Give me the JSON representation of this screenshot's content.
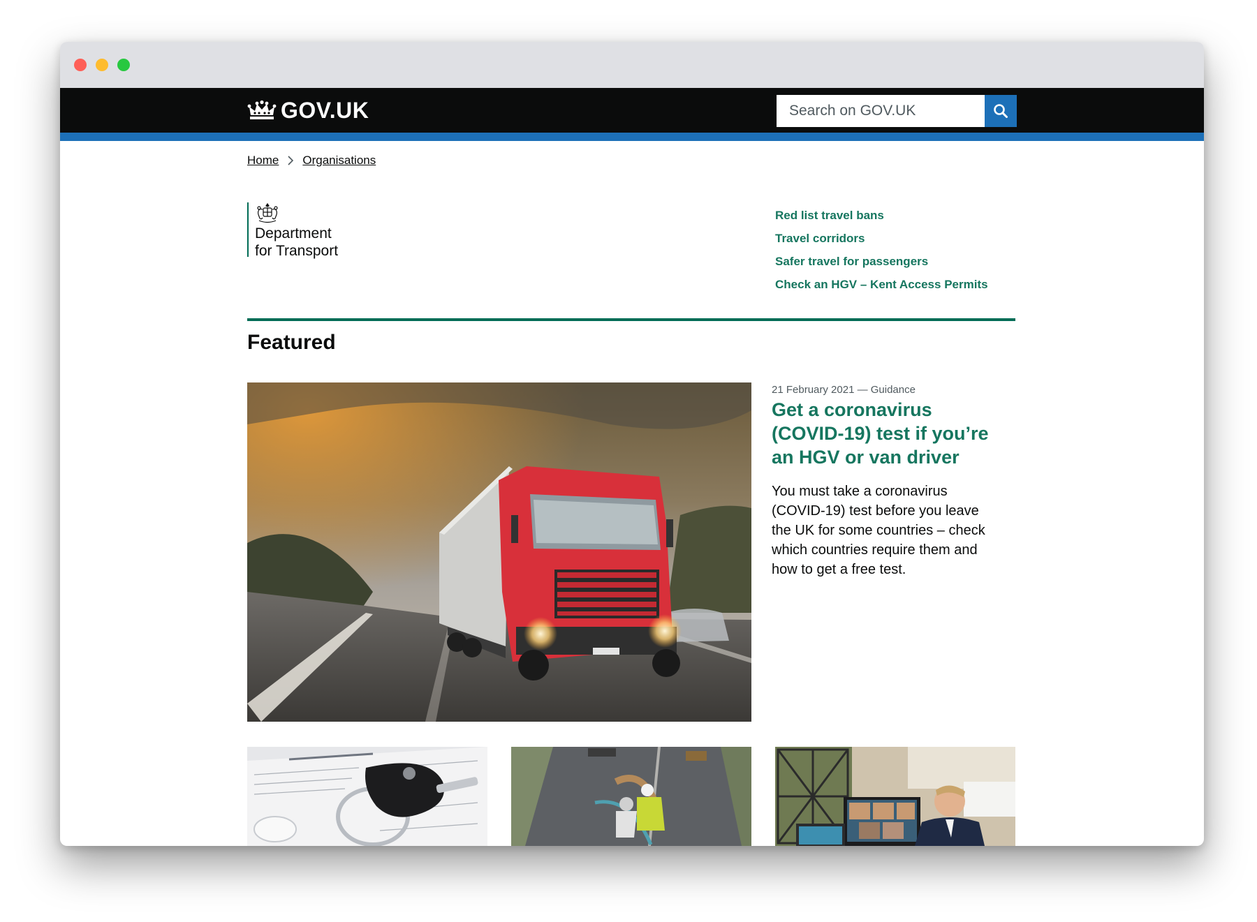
{
  "window": {
    "controls": [
      "close",
      "minimize",
      "maximize"
    ]
  },
  "header": {
    "logo_text": "GOV.UK",
    "logo_icon": "crown-icon",
    "search_placeholder": "Search on GOV.UK",
    "search_icon": "search-icon"
  },
  "breadcrumb": {
    "items": [
      {
        "label": "Home"
      },
      {
        "label": "Organisations"
      }
    ]
  },
  "organisation": {
    "name_line1": "Department",
    "name_line2": "for Transport",
    "crest_icon": "royal-arms-icon",
    "brand_color": "#006c56"
  },
  "quick_links": [
    {
      "label": "Red list travel bans"
    },
    {
      "label": "Travel corridors"
    },
    {
      "label": "Safer travel for passengers"
    },
    {
      "label": "Check an HGV – Kent Access Permits"
    }
  ],
  "featured": {
    "heading": "Featured",
    "main": {
      "meta": "21 February 2021 — Guidance",
      "title": "Get a coronavirus (COVID-19) test if you’re an HGV or van driver",
      "summary": "You must take a coronavirus (COVID-19) test before you leave the UK for some countries – check which countries require them and how to get a free test."
    }
  },
  "colors": {
    "header_bg": "#0b0c0c",
    "header_stripe": "#1d70b8",
    "link_green": "#16765f",
    "text": "#0b0c0c",
    "secondary_text": "#505a5f"
  }
}
